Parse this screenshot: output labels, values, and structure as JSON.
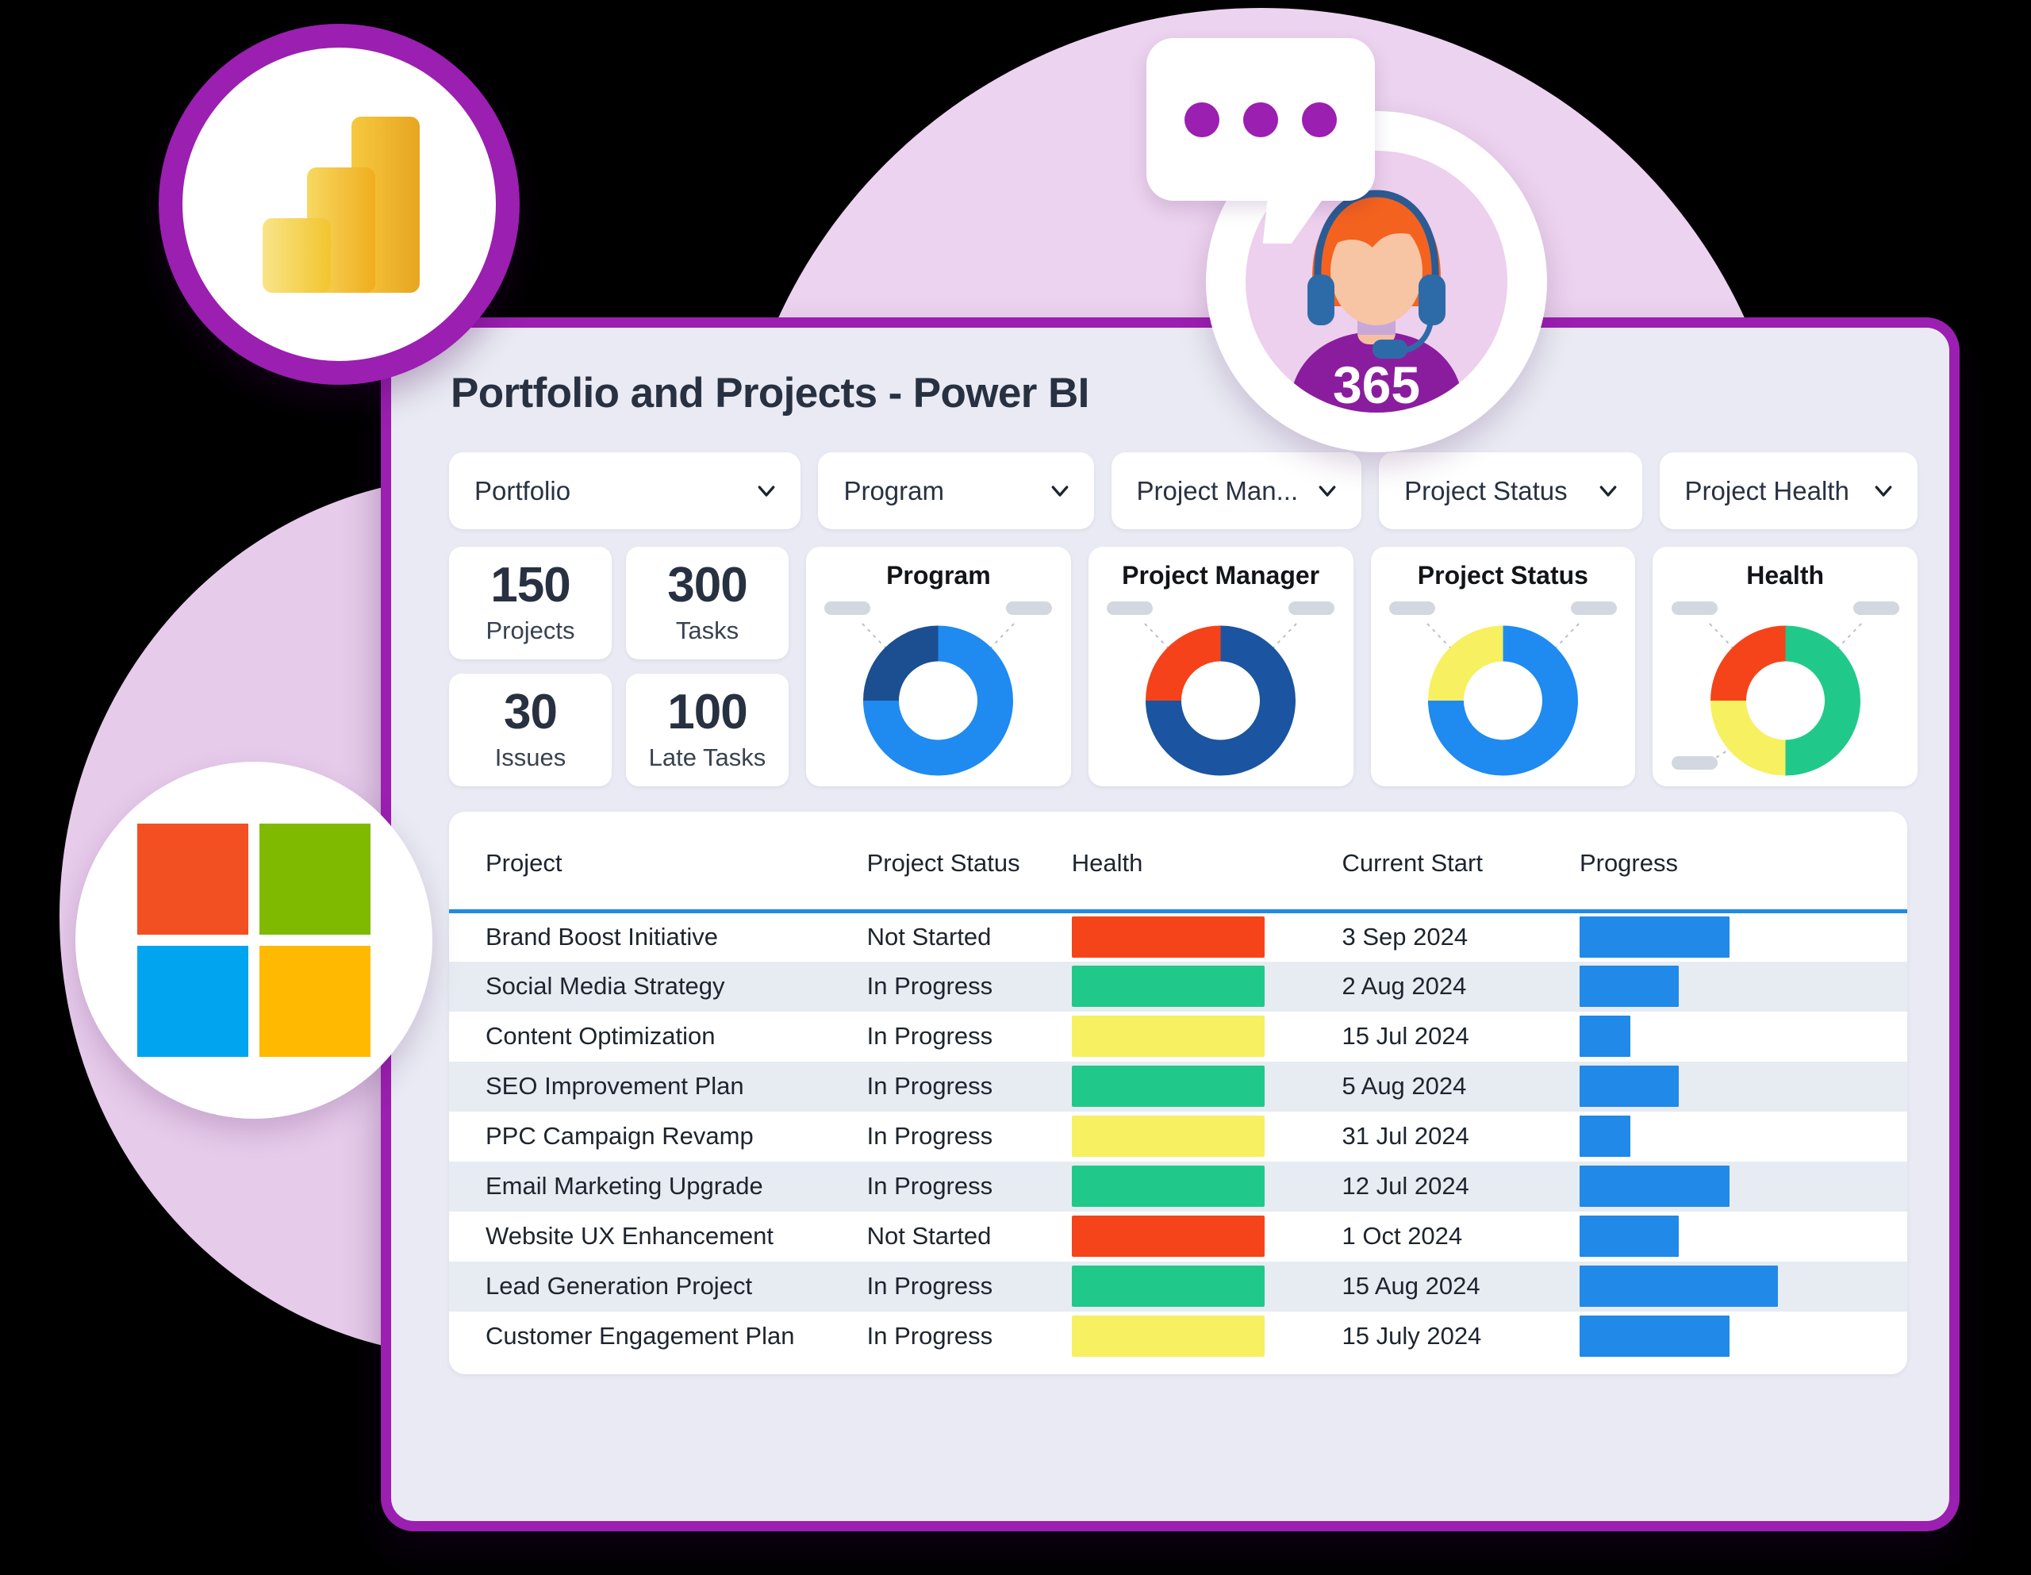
{
  "dashboard": {
    "title": "Portfolio and Projects - Power BI",
    "filters": [
      {
        "label": "Portfolio",
        "icon": "chevron-down-icon"
      },
      {
        "label": "Program",
        "icon": "chevron-down-icon"
      },
      {
        "label": "Project Man...",
        "icon": "chevron-down-icon"
      },
      {
        "label": "Project Status",
        "icon": "chevron-down-icon"
      },
      {
        "label": "Project Health",
        "icon": "chevron-down-icon"
      }
    ],
    "kpis": [
      {
        "value": "150",
        "label": "Projects"
      },
      {
        "value": "300",
        "label": "Tasks"
      },
      {
        "value": "30",
        "label": "Issues"
      },
      {
        "value": "100",
        "label": "Late Tasks"
      }
    ],
    "table": {
      "columns": [
        "Project",
        "Project Status",
        "Health",
        "Current Start",
        "Progress"
      ],
      "rows": [
        {
          "project": "Brand Boost Initiative",
          "status": "Not Started",
          "health": "red",
          "start": "3 Sep 2024",
          "progress": 62
        },
        {
          "project": "Social Media Strategy",
          "status": "In Progress",
          "health": "green",
          "start": "2 Aug 2024",
          "progress": 41
        },
        {
          "project": "Content Optimization",
          "status": "In Progress",
          "health": "yellow",
          "start": "15 Jul 2024",
          "progress": 21
        },
        {
          "project": "SEO Improvement Plan",
          "status": "In Progress",
          "health": "green",
          "start": "5 Aug 2024",
          "progress": 41
        },
        {
          "project": "PPC Campaign Revamp",
          "status": "In Progress",
          "health": "yellow",
          "start": "31 Jul 2024",
          "progress": 21
        },
        {
          "project": "Email Marketing Upgrade",
          "status": "In Progress",
          "health": "green",
          "start": "12 Jul 2024",
          "progress": 62
        },
        {
          "project": "Website UX Enhancement",
          "status": "Not Started",
          "health": "red",
          "start": "1 Oct 2024",
          "progress": 41
        },
        {
          "project": "Lead Generation Project",
          "status": "In Progress",
          "health": "green",
          "start": "15 Aug 2024",
          "progress": 82
        },
        {
          "project": "Customer Engagement Plan",
          "status": "In Progress",
          "health": "yellow",
          "start": "15 July 2024",
          "progress": 62
        }
      ]
    }
  },
  "badges": {
    "powerbi": {
      "name": "power-bi-logo",
      "ring_color": "#9b1fb0"
    },
    "microsoft": {
      "name": "microsoft-logo",
      "squares": [
        "#f25022",
        "#7fba00",
        "#00a4ef",
        "#ffb900"
      ]
    },
    "support": {
      "label": "365",
      "name": "support-agent-avatar"
    },
    "chat": {
      "name": "chat-bubble",
      "dot_color": "#9b1fb0",
      "dots": 3
    }
  },
  "colors": {
    "brand_purple": "#9b1fb0",
    "panel_bg": "#e9eaf3",
    "accent_blue": "#2189e8",
    "health_red": "#f5441a",
    "health_green": "#20c98a",
    "health_yellow": "#f7f061",
    "donut_dark_blue": "#1b4f91",
    "donut_blue": "#1f8af0",
    "donut_orange": "#f5421a"
  },
  "chart_data": [
    {
      "type": "pie",
      "title": "Program",
      "labels": [
        "",
        ""
      ],
      "values": [
        75,
        25
      ],
      "colors": [
        "#1f8af0",
        "#1b4f91"
      ],
      "legend": "leader-line-labels",
      "donut": true
    },
    {
      "type": "pie",
      "title": "Project Manager",
      "labels": [
        "",
        ""
      ],
      "values": [
        75,
        25
      ],
      "colors": [
        "#1b54a0",
        "#f5421a"
      ],
      "legend": "leader-line-labels",
      "donut": true
    },
    {
      "type": "pie",
      "title": "Project Status",
      "labels": [
        "",
        ""
      ],
      "values": [
        75,
        25
      ],
      "colors": [
        "#1f8af0",
        "#f7f061"
      ],
      "legend": "leader-line-labels",
      "donut": true
    },
    {
      "type": "pie",
      "title": "Health",
      "labels": [
        "",
        "",
        ""
      ],
      "values": [
        50,
        25,
        25
      ],
      "colors": [
        "#20c98a",
        "#f5441a",
        "#f7f061"
      ],
      "legend": "leader-line-labels",
      "donut": true
    },
    {
      "type": "bar",
      "title": "Progress",
      "orientation": "horizontal",
      "categories": [
        "Brand Boost Initiative",
        "Social Media Strategy",
        "Content Optimization",
        "SEO Improvement Plan",
        "PPC Campaign Revamp",
        "Email Marketing Upgrade",
        "Website UX Enhancement",
        "Lead Generation Project",
        "Customer Engagement Plan"
      ],
      "values": [
        62,
        41,
        21,
        41,
        21,
        62,
        41,
        82,
        62
      ],
      "xlabel": "",
      "ylabel": "",
      "xlim": [
        0,
        100
      ],
      "color": "#2189e8",
      "grid": false
    }
  ]
}
